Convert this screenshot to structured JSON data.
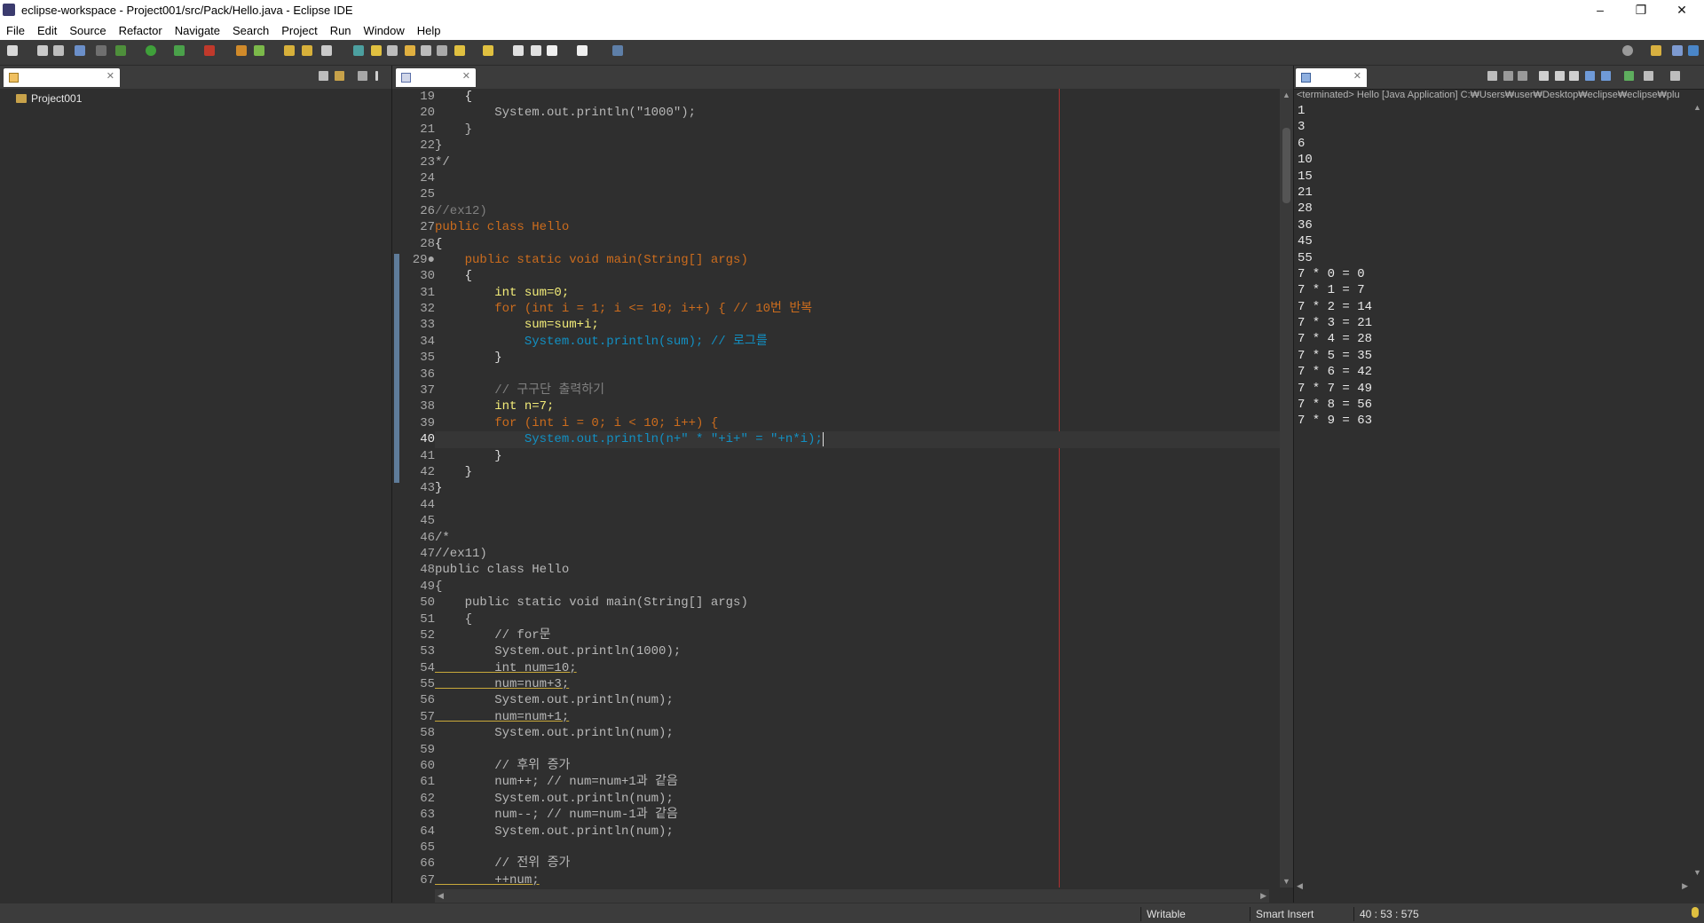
{
  "window": {
    "title": "eclipse-workspace - Project001/src/Pack/Hello.java - Eclipse IDE",
    "minimize": "–",
    "restore": "❐",
    "close": "✕"
  },
  "menu": [
    "File",
    "Edit",
    "Source",
    "Refactor",
    "Navigate",
    "Search",
    "Project",
    "Run",
    "Window",
    "Help"
  ],
  "explorer": {
    "tab_label": "",
    "items": [
      "Project001"
    ]
  },
  "editor": {
    "tab_label": "",
    "current_line": 40,
    "line_numbers": [
      19,
      20,
      21,
      22,
      23,
      24,
      25,
      26,
      27,
      28,
      29,
      30,
      31,
      32,
      33,
      34,
      35,
      36,
      37,
      38,
      39,
      40,
      41,
      42,
      43,
      44,
      45,
      46,
      47,
      48,
      49,
      50,
      51,
      52,
      53,
      54,
      55,
      56,
      57,
      58,
      59,
      60,
      61,
      62,
      63,
      64,
      65,
      66,
      67
    ],
    "fold_marker": "●",
    "lines": [
      "    {",
      "        System.out.println(\"1000\");",
      "    }",
      "}",
      "*/",
      "",
      "",
      "//ex12)",
      "public class Hello",
      "{",
      "    public static void main(String[] args)",
      "    {",
      "        int sum=0;",
      "        for (int i = 1; i <= 10; i++) { // 10번 반복",
      "            sum=sum+i;",
      "            System.out.println(sum); // 로그를",
      "        }",
      "",
      "        // 구구단 출력하기",
      "        int n=7;",
      "        for (int i = 0; i < 10; i++) {",
      "            System.out.println(n+\" * \"+i+\" = \"+n*i);",
      "        }",
      "    }",
      "}",
      "",
      "",
      "/*",
      "//ex11)",
      "public class Hello",
      "{",
      "    public static void main(String[] args)",
      "    {",
      "        // for문",
      "        System.out.println(1000);",
      "        int num=10;",
      "        num=num+3;",
      "        System.out.println(num);",
      "        num=num+1;",
      "        System.out.println(num);",
      "",
      "        // 후위 증가",
      "        num++; // num=num+1과 같음",
      "        System.out.println(num);",
      "        num--; // num=num-1과 같음",
      "        System.out.println(num);",
      "",
      "        // 전위 증가",
      "        ++num;"
    ]
  },
  "console": {
    "tab_label": "",
    "header": "<terminated> Hello [Java Application] C:₩Users₩user₩Desktop₩eclipse₩eclipse₩plu",
    "output": [
      "1",
      "3",
      "6",
      "10",
      "15",
      "21",
      "28",
      "36",
      "45",
      "55",
      "7 * 0 = 0",
      "7 * 1 = 7",
      "7 * 2 = 14",
      "7 * 3 = 21",
      "7 * 4 = 28",
      "7 * 5 = 35",
      "7 * 6 = 42",
      "7 * 7 = 49",
      "7 * 8 = 56",
      "7 * 9 = 63"
    ]
  },
  "status": {
    "writable": "Writable",
    "insert_mode": "Smart Insert",
    "position": "40 : 53 : 575"
  },
  "colors": {
    "background": "#2f2f2f",
    "keyword": "#cc6c1d",
    "method": "#a7ec21",
    "type": "#1290c3",
    "number": "#6897bb",
    "field": "#66e1f8",
    "variable": "#f3ec79",
    "comment": "#808080",
    "print_margin": "#b03030"
  }
}
